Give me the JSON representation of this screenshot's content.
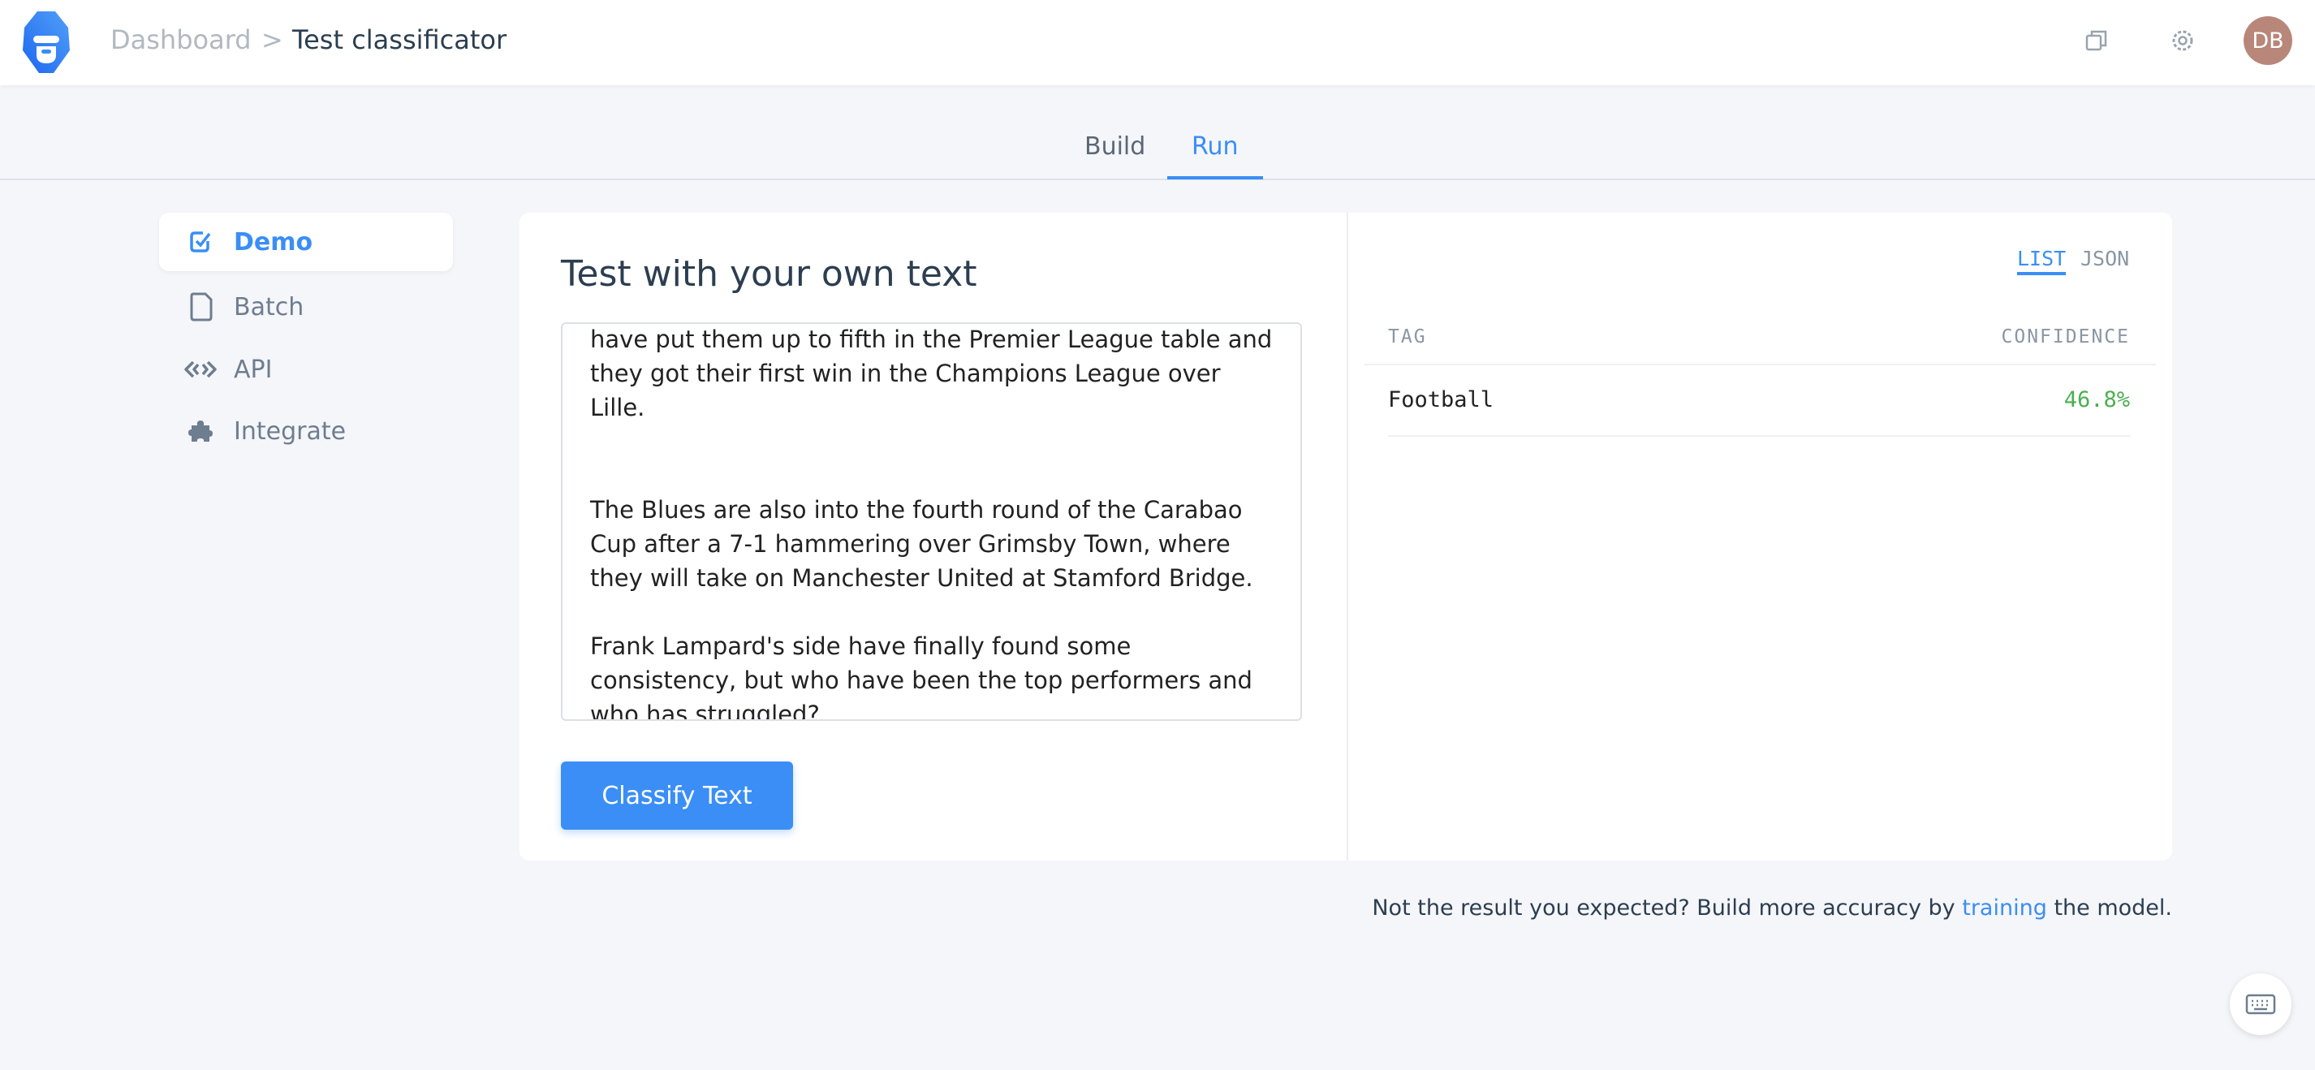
{
  "header": {
    "breadcrumb": [
      "Dashboard",
      "Test classificator"
    ],
    "separator": ">",
    "avatar_initials": "DB",
    "avatar_color": "#b8877a"
  },
  "tabs": [
    {
      "label": "Build"
    },
    {
      "label": "Run",
      "active": true
    }
  ],
  "sidebar": {
    "items": [
      {
        "label": "Demo",
        "icon": "checkbox-icon",
        "active": true
      },
      {
        "label": "Batch",
        "icon": "file-icon"
      },
      {
        "label": "API",
        "icon": "code-icon"
      },
      {
        "label": "Integrate",
        "icon": "puzzle-icon"
      }
    ]
  },
  "demo": {
    "title": "Test with your own text",
    "text_paragraphs": [
      "have put them up to fifth in the Premier League table and they got their first win in the Champions League over Lille.",
      "",
      "The Blues are also into the fourth round of the Carabao Cup after a 7-1 hammering over Grimsby Town, where they will take on Manchester United at Stamford Bridge.",
      "Frank Lampard's side have finally found some consistency, but who have been the top performers and who has struggled?"
    ],
    "classify_label": "Classify Text"
  },
  "results": {
    "formats": [
      "LIST",
      "JSON"
    ],
    "active_format": "LIST",
    "columns": [
      "TAG",
      "CONFIDENCE"
    ],
    "rows": [
      {
        "tag": "Football",
        "confidence": "46.8%"
      }
    ],
    "confidence_color": "#4caf50"
  },
  "footer": {
    "prefix": "Not the result you expected? Build more accuracy by ",
    "link": "training",
    "suffix": " the model."
  },
  "colors": {
    "accent": "#3a8ef6"
  }
}
